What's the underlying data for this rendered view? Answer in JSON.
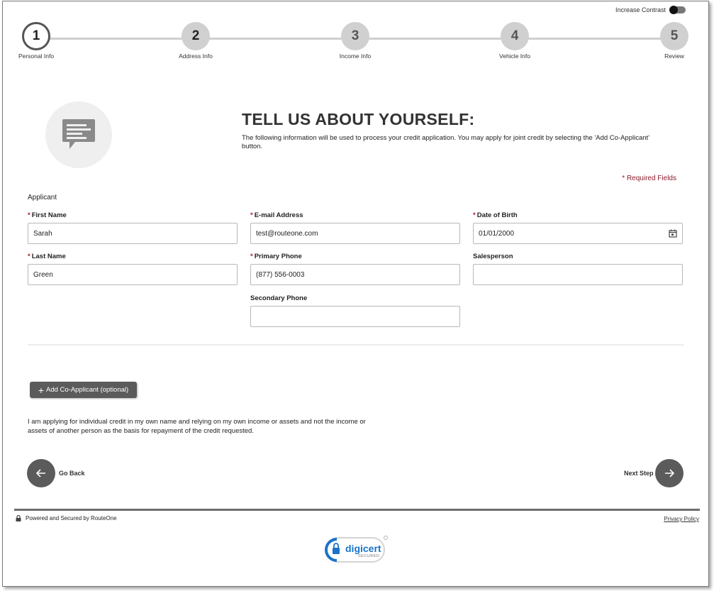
{
  "contrast": {
    "label": "Increase Contrast"
  },
  "steps": [
    {
      "number": "1",
      "label": "Personal Info"
    },
    {
      "number": "2",
      "label": "Address Info"
    },
    {
      "number": "3",
      "label": "Income Info"
    },
    {
      "number": "4",
      "label": "Vehicle Info"
    },
    {
      "number": "5",
      "label": "Review"
    }
  ],
  "hero": {
    "title": "TELL US ABOUT YOURSELF:",
    "intro": "The following information will be used to process your credit application. You may apply for joint credit by selecting the 'Add Co-Applicant' button."
  },
  "required_note": "* Required Fields",
  "section_label": "Applicant",
  "form": {
    "first_name": {
      "label": "First Name",
      "value": "Sarah"
    },
    "last_name": {
      "label": "Last Name",
      "value": "Green"
    },
    "email": {
      "label": "E-mail Address",
      "value": "test@routeone.com"
    },
    "primary_phone": {
      "label": "Primary Phone",
      "value": "(877) 556-0003"
    },
    "secondary_phone": {
      "label": "Secondary Phone",
      "value": ""
    },
    "dob": {
      "label": "Date of Birth",
      "value": "01/01/2000"
    },
    "salesperson": {
      "label": "Salesperson",
      "value": ""
    }
  },
  "co_applicant_button": "Add Co-Applicant (optional)",
  "disclaimer": "I am applying for individual credit in my own name and relying on my own income or assets and not the income or assets of another person as the basis for repayment of the credit requested.",
  "nav": {
    "back": "Go Back",
    "next": "Next Step"
  },
  "footer": {
    "powered": "Powered and Secured by RouteOne",
    "privacy": "Privacy Policy",
    "badge_name": "digicert",
    "badge_sub": "SECURED"
  },
  "colors": {
    "accent": "#5b5b5b",
    "required": "#8b1a2b",
    "badge_blue": "#1a73c9"
  }
}
